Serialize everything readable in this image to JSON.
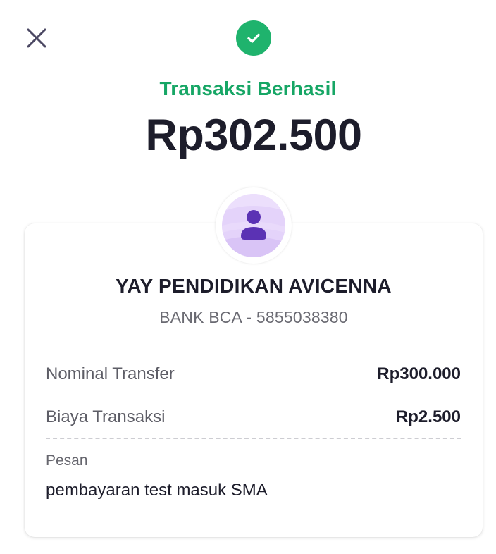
{
  "header": {
    "close_icon": "close-icon",
    "status_icon": "check-circle-icon",
    "status_title": "Transaksi Berhasil",
    "amount": "Rp302.500"
  },
  "recipient": {
    "avatar_icon": "person-icon",
    "name": "YAY PENDIDIKAN AVICENNA",
    "account": "BANK BCA - 5855038380"
  },
  "details": {
    "nominal_label": "Nominal Transfer",
    "nominal_value": "Rp300.000",
    "fee_label": "Biaya Transaksi",
    "fee_value": "Rp2.500"
  },
  "message": {
    "label": "Pesan",
    "text": "pembayaran test masuk SMA"
  },
  "colors": {
    "success": "#16a665",
    "avatar_bg": "#e6d6fb",
    "avatar_icon": "#5b32b4"
  }
}
